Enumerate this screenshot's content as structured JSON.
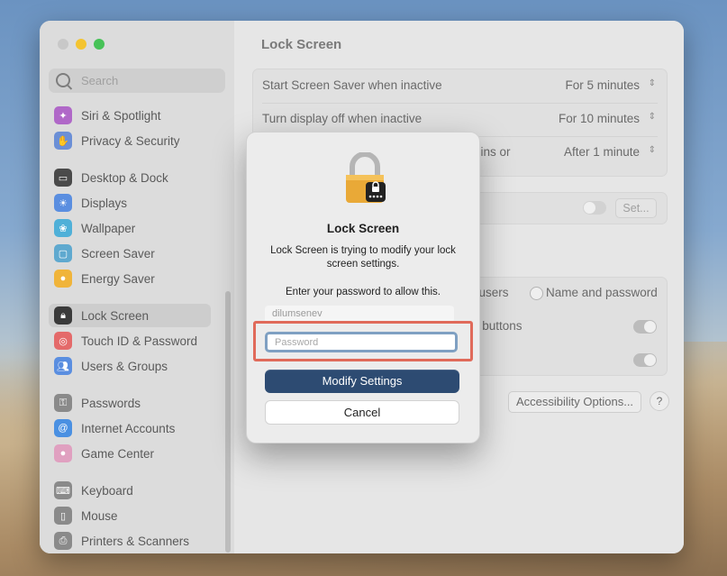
{
  "sidebar": {
    "search_placeholder": "Search",
    "items": [
      {
        "label": "Siri & Spotlight",
        "icon": "siri-icon",
        "color": "#b068c8"
      },
      {
        "label": "Privacy & Security",
        "icon": "hand-icon",
        "color": "#6b8fd6"
      },
      {
        "label": "Desktop & Dock",
        "icon": "dock-icon",
        "color": "#4a4a4a"
      },
      {
        "label": "Displays",
        "icon": "sun-icon",
        "color": "#5a8ee0"
      },
      {
        "label": "Wallpaper",
        "icon": "flower-icon",
        "color": "#4fb0d8"
      },
      {
        "label": "Screen Saver",
        "icon": "screen-saver-icon",
        "color": "#5fa9cf"
      },
      {
        "label": "Energy Saver",
        "icon": "lightbulb-icon",
        "color": "#f0b43a"
      },
      {
        "label": "Lock Screen",
        "icon": "lock-icon",
        "color": "#3a3a3a"
      },
      {
        "label": "Touch ID & Password",
        "icon": "fingerprint-icon",
        "color": "#e46a6a"
      },
      {
        "label": "Users & Groups",
        "icon": "users-icon",
        "color": "#5a8ee0"
      },
      {
        "label": "Passwords",
        "icon": "key-icon",
        "color": "#8a8a8a"
      },
      {
        "label": "Internet Accounts",
        "icon": "at-icon",
        "color": "#4a90e2"
      },
      {
        "label": "Game Center",
        "icon": "game-center-icon",
        "color": "#e0a0c0"
      },
      {
        "label": "Keyboard",
        "icon": "keyboard-icon",
        "color": "#8a8a8a"
      },
      {
        "label": "Mouse",
        "icon": "mouse-icon",
        "color": "#8a8a8a"
      },
      {
        "label": "Printers & Scanners",
        "icon": "printer-icon",
        "color": "#8a8a8a"
      }
    ]
  },
  "main": {
    "title": "Lock Screen",
    "rows": [
      {
        "label": "Start Screen Saver when inactive",
        "value": "For 5 minutes"
      },
      {
        "label": "Turn display off when inactive",
        "value": "For 10 minutes"
      },
      {
        "label": "gins or",
        "value": "After 1 minute"
      }
    ],
    "set_button": "Set...",
    "login_users_partial": "f users",
    "name_and_password": "Name and password",
    "buttons_partial": "n buttons",
    "accessibility_button": "Accessibility Options...",
    "help": "?"
  },
  "dialog": {
    "title": "Lock Screen",
    "message": "Lock Screen is trying to modify your lock screen settings.",
    "prompt": "Enter your password to allow this.",
    "username": "dilumsenev",
    "password_placeholder": "Password",
    "primary_button": "Modify Settings",
    "cancel_button": "Cancel"
  },
  "colors": {
    "primary_button": "#2d4b72",
    "highlight": "#e06a5a",
    "focus_ring": "#7fa0c2"
  }
}
